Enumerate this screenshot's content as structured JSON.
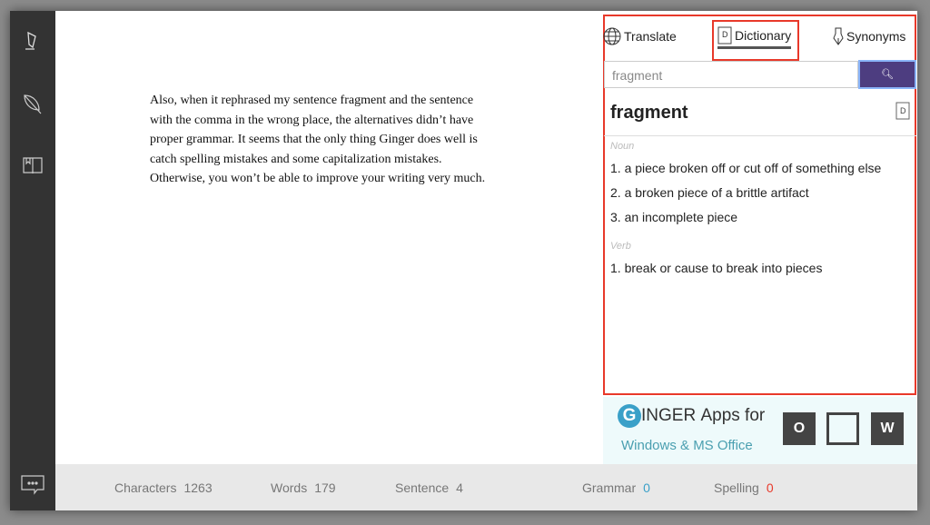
{
  "sidebar": {
    "icons": [
      "highlighter-icon",
      "feather-icon",
      "book-icon"
    ],
    "bottom_icon": "chat-icon"
  },
  "document": {
    "text": "Also, when it rephrased my sentence fragment and the sentence with the comma in the wrong place, the alternatives didn’t have proper grammar. It seems that the only thing Ginger does well is catch spelling mistakes and some capitalization mistakes. Otherwise, you won’t be able to improve your writing very much."
  },
  "panel": {
    "tabs": [
      {
        "label": "Translate",
        "icon": "globe-icon"
      },
      {
        "label": "Dictionary",
        "icon": "dictionary-icon",
        "active": true
      },
      {
        "label": "Synonyms",
        "icon": "pen-icon"
      }
    ],
    "search": {
      "value": "fragment"
    },
    "word": "fragment",
    "senses": [
      {
        "pos": "Noun",
        "defs": [
          "1. a piece broken off or cut off of something else",
          "2. a broken piece of a brittle artifact",
          "3. an incomplete piece"
        ]
      },
      {
        "pos": "Verb",
        "defs": [
          "1. break or cause to break into pieces"
        ]
      }
    ]
  },
  "ad": {
    "brand": "INGER",
    "line1": "Apps for",
    "line2": "Windows & MS Office"
  },
  "status": {
    "characters_label": "Characters",
    "characters": "1263",
    "words_label": "Words",
    "words": "179",
    "sentence_label": "Sentence",
    "sentence": "4",
    "grammar_label": "Grammar",
    "grammar": "0",
    "spelling_label": "Spelling",
    "spelling": "0"
  },
  "colors": {
    "highlight": "#e8392a",
    "accent": "#4d3d80",
    "grammar": "#3aa0c8",
    "spelling": "#e8392a"
  }
}
